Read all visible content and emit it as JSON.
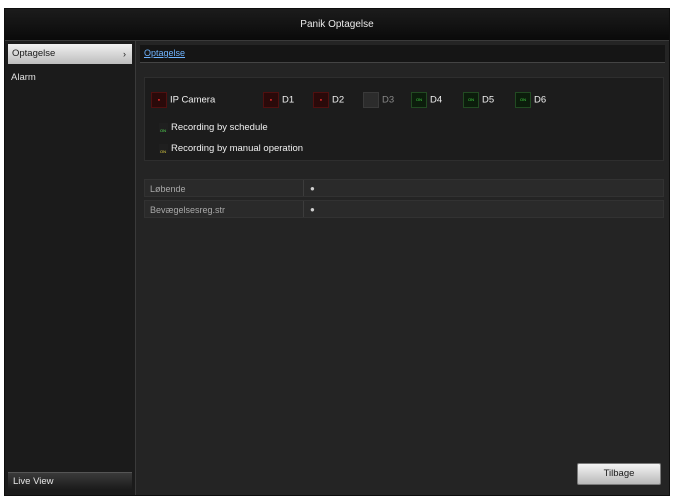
{
  "title": "Panik Optagelse",
  "sidebar": {
    "items": [
      {
        "label": "Optagelse",
        "active": true,
        "chevron": "›"
      },
      {
        "label": "Alarm",
        "active": false
      }
    ],
    "footer_label": "Live View"
  },
  "tabs": [
    {
      "label": "Optagelse"
    }
  ],
  "status": {
    "channels": [
      {
        "label": "IP Camera",
        "state": "red",
        "glyph": "●"
      },
      {
        "label": "D1",
        "state": "red",
        "glyph": "●"
      },
      {
        "label": "D2",
        "state": "red",
        "glyph": "●"
      },
      {
        "label": "D3",
        "state": "grey",
        "glyph": ""
      },
      {
        "label": "D4",
        "state": "green",
        "glyph": "ON"
      },
      {
        "label": "D5",
        "state": "green",
        "glyph": "ON"
      },
      {
        "label": "D6",
        "state": "green",
        "glyph": "ON"
      }
    ],
    "legend": [
      {
        "label": "Recording by schedule",
        "color": "#55e055",
        "glyph": "ON"
      },
      {
        "label": "Recording by manual operation",
        "color": "#e8d840",
        "glyph": "ON"
      }
    ]
  },
  "settings": [
    {
      "label": "Løbende",
      "value": "●"
    },
    {
      "label": "Bevægelsesreg.str",
      "value": "●"
    }
  ],
  "buttons": {
    "back": "Tilbage"
  },
  "colors": {
    "background": "#202020",
    "accent_link": "#6fb4ff",
    "red": "#ff3030",
    "green": "#44dd44"
  }
}
